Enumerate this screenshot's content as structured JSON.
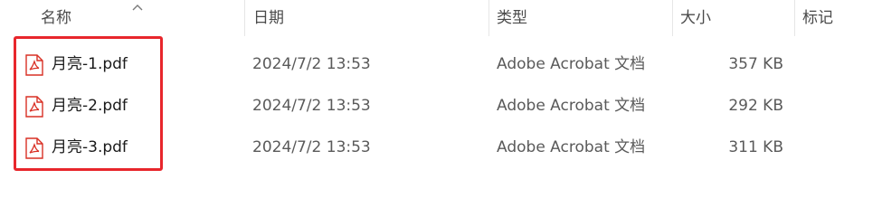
{
  "columns": {
    "name": "名称",
    "date": "日期",
    "type": "类型",
    "size": "大小",
    "tags": "标记"
  },
  "files": [
    {
      "name": "月亮-1.pdf",
      "date": "2024/7/2 13:53",
      "type": "Adobe Acrobat 文档",
      "size": "357 KB",
      "icon": "pdf-file-icon"
    },
    {
      "name": "月亮-2.pdf",
      "date": "2024/7/2 13:53",
      "type": "Adobe Acrobat 文档",
      "size": "292 KB",
      "icon": "pdf-file-icon"
    },
    {
      "name": "月亮-3.pdf",
      "date": "2024/7/2 13:53",
      "type": "Adobe Acrobat 文档",
      "size": "311 KB",
      "icon": "pdf-file-icon"
    }
  ],
  "colors": {
    "pdf_icon": "#d93025",
    "highlight": "#e8262c"
  }
}
